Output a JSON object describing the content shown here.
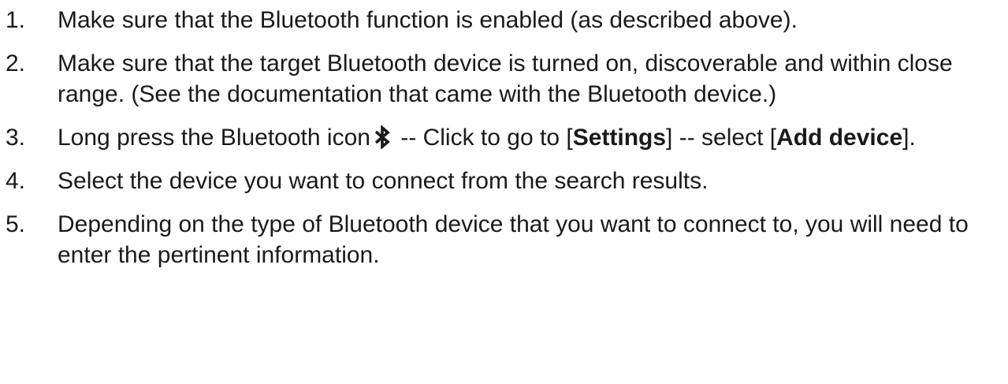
{
  "steps": [
    {
      "number": "1.",
      "text": "Make sure that the Bluetooth function is enabled (as described above)."
    },
    {
      "number": "2.",
      "text": "Make sure that the target Bluetooth device is turned on, discoverable and within close range. (See the documentation that came with the Bluetooth device.)"
    },
    {
      "number": "3.",
      "part1": "Long press the Bluetooth icon",
      "part2": " -- Click to go to [",
      "bold1": "Settings",
      "part3": "] -- select [",
      "bold2": "Add device",
      "part4": "].",
      "icon": "bluetooth-icon"
    },
    {
      "number": "4.",
      "text": "Select the device you want to connect from the search results."
    },
    {
      "number": "5.",
      "text": "Depending on the type of Bluetooth device that you want to connect to, you will need to enter the pertinent information."
    }
  ]
}
